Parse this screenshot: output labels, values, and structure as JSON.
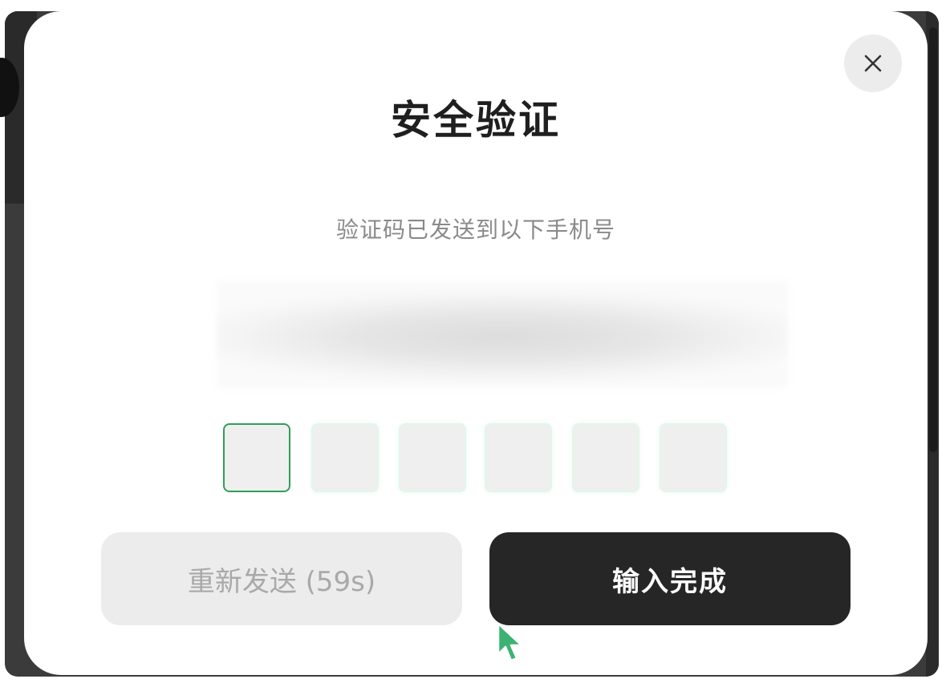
{
  "dialog": {
    "title": "安全验证",
    "subtitle": "验证码已发送到以下手机号",
    "code_length": 6,
    "code_values": [
      "",
      "",
      "",
      "",
      "",
      ""
    ],
    "close_icon": "close-icon",
    "resend_label": "重新发送 (59s)",
    "confirm_label": "输入完成"
  },
  "colors": {
    "active_box_border": "#2f9e58",
    "confirm_button": "#262626",
    "resend_button": "#ececec",
    "cursor": "#3cb371"
  }
}
